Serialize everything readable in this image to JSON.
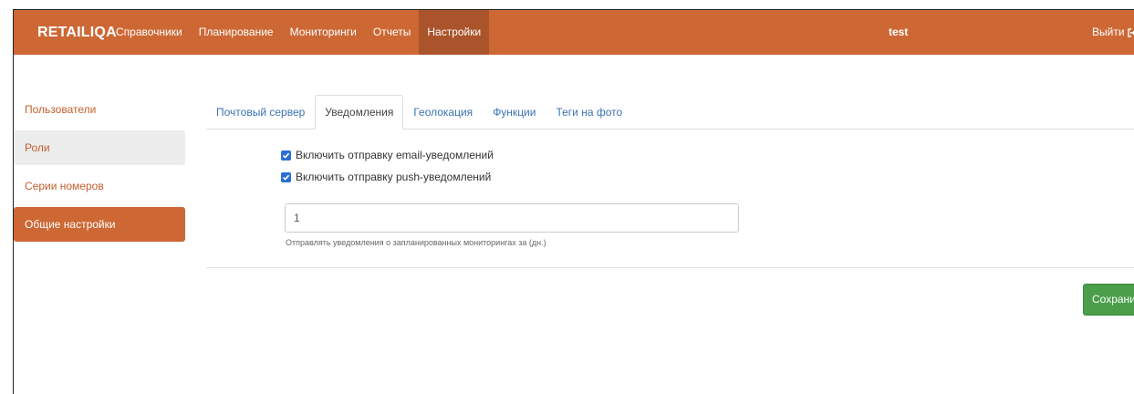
{
  "header": {
    "brand": "RETAILIQA",
    "menu": [
      {
        "label": "Справочники"
      },
      {
        "label": "Планирование"
      },
      {
        "label": "Мониторинги"
      },
      {
        "label": "Отчеты"
      },
      {
        "label": "Настройки",
        "active": true
      }
    ],
    "user": "test",
    "logout_label": "Выйти",
    "logout_icon": "logout-icon"
  },
  "sidebar": {
    "items": [
      {
        "label": "Пользователи"
      },
      {
        "label": "Роли",
        "state": "hover"
      },
      {
        "label": "Серии номеров"
      },
      {
        "label": "Общие настройки",
        "state": "active"
      }
    ]
  },
  "tabs": [
    {
      "label": "Почтовый сервер"
    },
    {
      "label": "Уведомления",
      "active": true
    },
    {
      "label": "Геолокация"
    },
    {
      "label": "Функции"
    },
    {
      "label": "Теги на фото"
    }
  ],
  "notifications": {
    "email_label": "Включить отправку email-уведомлений",
    "email_checked": true,
    "push_label": "Включить отправку push-уведомлений",
    "push_checked": true,
    "days_value": "1",
    "days_help": "Отправлять уведомления о запланированных мониторингах за (дн.)"
  },
  "actions": {
    "save_label": "Сохранить"
  },
  "colors": {
    "brand": "#cd6835",
    "brand_dark": "#a9542b",
    "link": "#3a73b3",
    "checkbox": "#2b6fd6",
    "save": "#4a9e4a"
  }
}
